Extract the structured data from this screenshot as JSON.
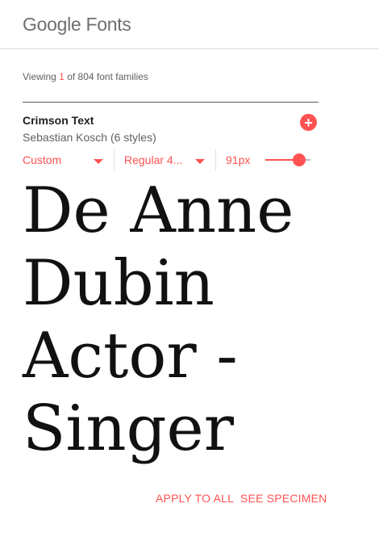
{
  "header": {
    "logo_text": "Google Fonts"
  },
  "summary": {
    "prefix": "Viewing",
    "count": "1",
    "suffix": "of 804 font families"
  },
  "font_card": {
    "name": "Crimson Text",
    "author": "Sebastian Kosch (6 styles)",
    "add_icon": "plus-circle-icon",
    "sentence_select": "Custom",
    "style_select": "Regular 4...",
    "size_label": "91px",
    "size_slider_fraction": 0.8,
    "preview_lines": [
      "De Anne",
      "Dubin",
      "Actor -",
      "Singer"
    ]
  },
  "actions": {
    "apply_to_all": "APPLY TO ALL",
    "see_specimen": "SEE SPECIMEN"
  },
  "colors": {
    "accent": "#ff5252",
    "text": "#212121",
    "muted": "#616161"
  }
}
